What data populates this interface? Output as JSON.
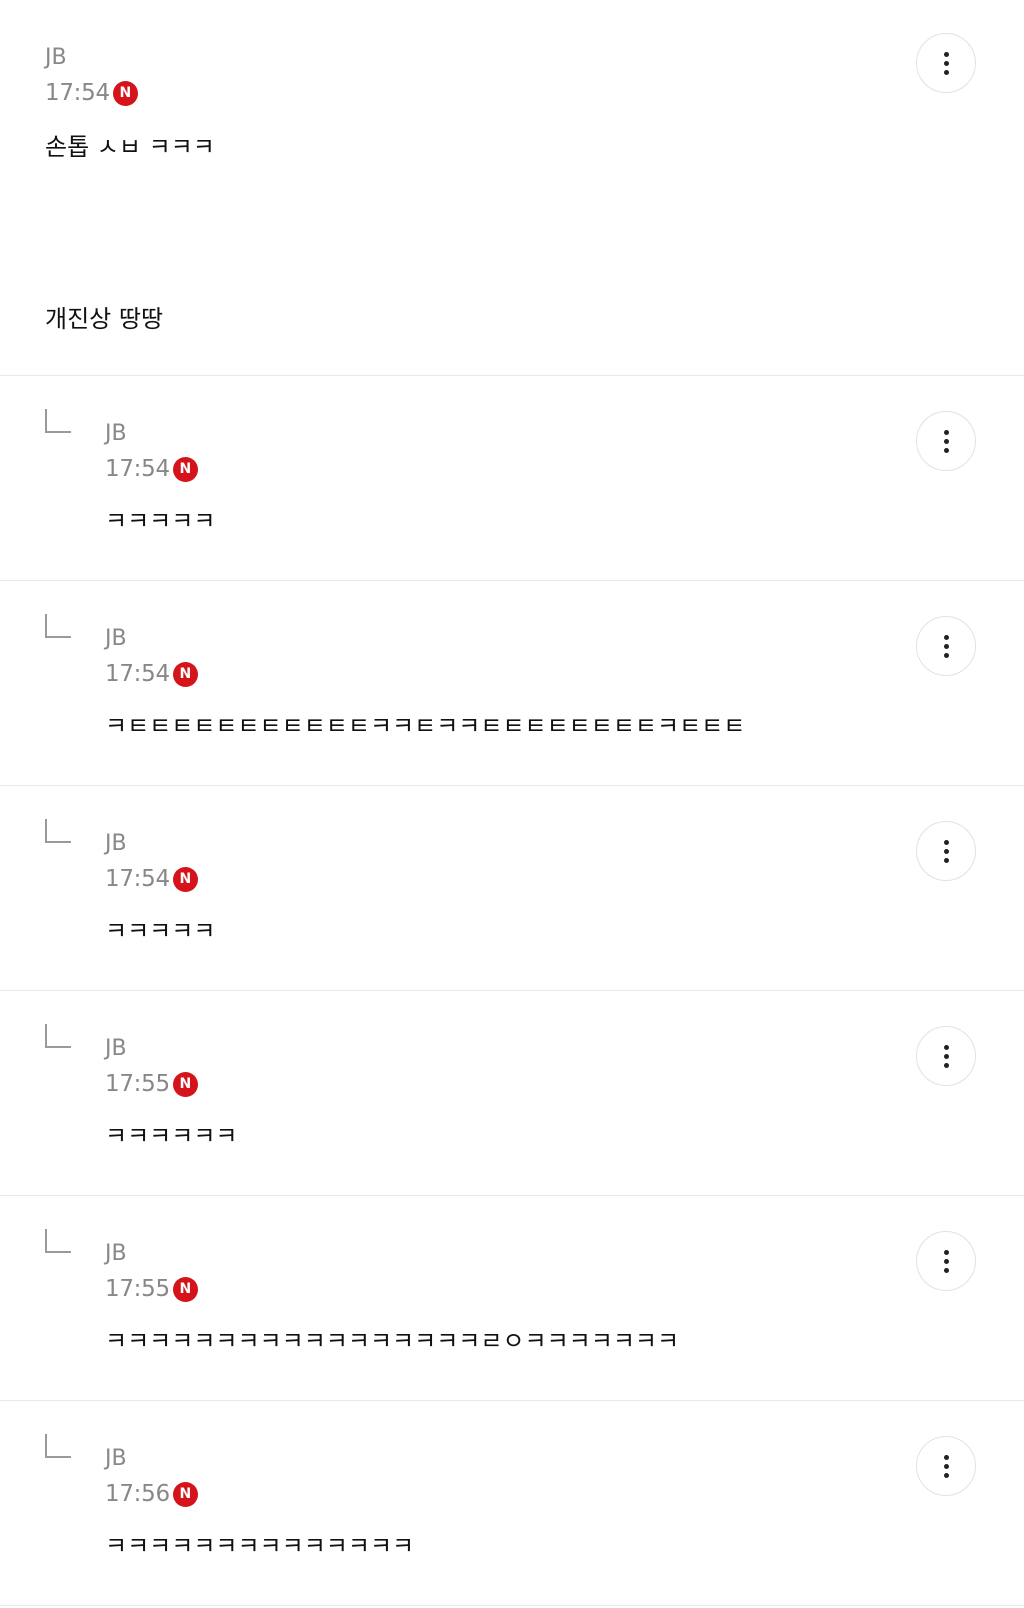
{
  "main_comment": {
    "author": "JB",
    "time": "17:54",
    "new_badge": "N",
    "lines": [
      "손톱 ㅅㅂ ㅋㅋㅋ",
      "개진상 땅땅"
    ]
  },
  "replies": [
    {
      "author": "JB",
      "time": "17:54",
      "new_badge": "N",
      "text": "ㅋㅋㅋㅋㅋ"
    },
    {
      "author": "JB",
      "time": "17:54",
      "new_badge": "N",
      "text": "ㅋㅌㅌㅌㅌㅌㅌㅌㅌㅌㅌㅌㅋㅋㅌㅋㅋㅌㅌㅌㅌㅌㅌㅌㅌㅋㅌㅌㅌ"
    },
    {
      "author": "JB",
      "time": "17:54",
      "new_badge": "N",
      "text": "ㅋㅋㅋㅋㅋ"
    },
    {
      "author": "JB",
      "time": "17:55",
      "new_badge": "N",
      "text": "ㅋㅋㅋㅋㅋㅋ"
    },
    {
      "author": "JB",
      "time": "17:55",
      "new_badge": "N",
      "text": "ㅋㅋㅋㅋㅋㅋㅋㅋㅋㅋㅋㅋㅋㅋㅋㅋㅋㄹㅇㅋㅋㅋㅋㅋㅋㅋ"
    },
    {
      "author": "JB",
      "time": "17:56",
      "new_badge": "N",
      "text": "ㅋㅋㅋㅋㅋㅋㅋㅋㅋㅋㅋㅋㅋㅋ"
    }
  ]
}
